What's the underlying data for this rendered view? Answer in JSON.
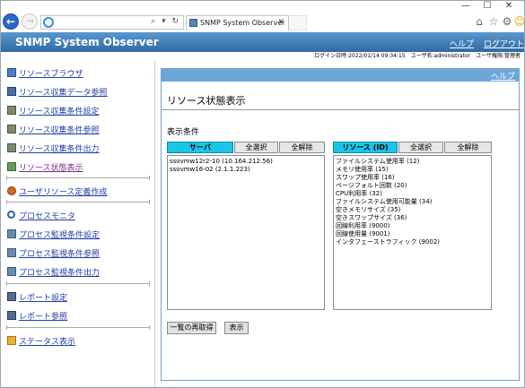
{
  "browser": {
    "tab_title": "SNMP System Observer",
    "address_tools": "⌕ ▾ ↻"
  },
  "header": {
    "app_title": "SNMP System Observer",
    "help_link": "ヘルプ",
    "logout_link": "ログアウト",
    "login_info": "ログイン日時:2022/01/14 09:34:15　ユーザ名:administrator　ユーザ権限:管理者"
  },
  "sidebar": {
    "items": [
      {
        "label": "リソースブラウザ",
        "icon": "resource-browser-icon"
      },
      {
        "label": "リソース収集データ参照",
        "icon": "data-reference-icon"
      },
      {
        "label": "リソース収集条件設定",
        "icon": "condition-setting-icon"
      },
      {
        "label": "リソース収集条件参照",
        "icon": "condition-reference-icon"
      },
      {
        "label": "リソース収集条件出力",
        "icon": "condition-output-icon"
      },
      {
        "label": "リソース状態表示",
        "icon": "status-display-icon"
      },
      {
        "label": "ユーザリソース定義作成",
        "icon": "user-resource-icon"
      },
      {
        "label": "プロセスモニタ",
        "icon": "magnifier-icon"
      },
      {
        "label": "プロセス監視条件設定",
        "icon": "process-setting-icon"
      },
      {
        "label": "プロセス監視条件参照",
        "icon": "process-reference-icon"
      },
      {
        "label": "プロセス監視条件出力",
        "icon": "process-output-icon"
      },
      {
        "label": "レポート設定",
        "icon": "report-setting-icon"
      },
      {
        "label": "レポート参照",
        "icon": "report-reference-icon"
      },
      {
        "label": "ステータス表示",
        "icon": "status-icon"
      }
    ]
  },
  "main": {
    "help_link": "ヘルプ",
    "page_title": "リソース状態表示",
    "section_title": "表示条件",
    "server_panel": {
      "header": "サーバ",
      "select_all": "全選択",
      "deselect_all": "全解除",
      "items": [
        "ssovmw12r2-10 (10.164.212.56)",
        "ssovmw16-02 (2.1.1.223)"
      ]
    },
    "resource_panel": {
      "header": "リソース (ID)",
      "select_all": "全選択",
      "deselect_all": "全解除",
      "items": [
        "ファイルシステム使用率 (12)",
        "メモリ使用率 (15)",
        "スワップ使用率 (16)",
        "ページフォルト回数 (20)",
        "CPU利用率 (32)",
        "ファイルシステム使用可能量 (34)",
        "空きメモリサイズ (35)",
        "空きスワップサイズ (36)",
        "回線利用率 (9000)",
        "回線使用量 (9001)",
        "インタフェーストラフィック (9002)"
      ]
    },
    "reload_button": "一覧の再取得",
    "display_button": "表示"
  },
  "colors": {
    "header_blue": "#3c7fb8",
    "panel_header_cyan": "#1ac6e6",
    "help_bar": "#6da7da",
    "link_blue": "#1f3fa8",
    "visited_purple": "#7b2b86"
  }
}
